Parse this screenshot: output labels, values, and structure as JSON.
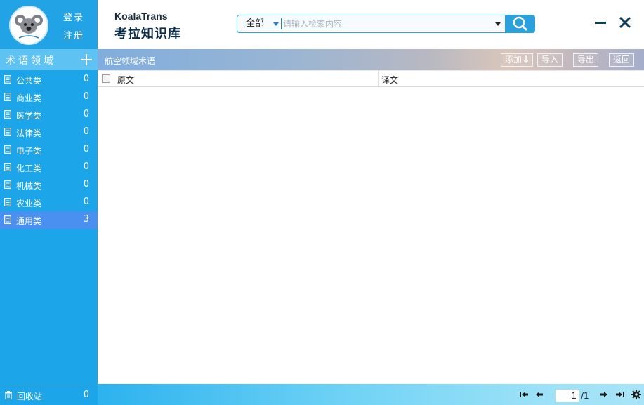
{
  "colors": {
    "sidebar": "#1ca6e9",
    "sidebar_active": "#4a90f0",
    "accent": "#2aa0dd",
    "brand_text": "#0b2d4a"
  },
  "header": {
    "logo_text": "Koala Trans",
    "login": "登录",
    "register": "注册",
    "brand_en": "KoalaTrans",
    "brand_cn": "考拉知识库",
    "search": {
      "scope": "全部",
      "placeholder": "请输入检索内容",
      "icon": "search-icon"
    },
    "window": {
      "minimize_icon": "minimize-icon",
      "close_icon": "close-icon"
    }
  },
  "sidebar": {
    "title": "术语领域",
    "add_icon": "plus-icon",
    "items": [
      {
        "label": "公共类",
        "count": "0",
        "active": false
      },
      {
        "label": "商业类",
        "count": "0",
        "active": false
      },
      {
        "label": "医学类",
        "count": "0",
        "active": false
      },
      {
        "label": "法律类",
        "count": "0",
        "active": false
      },
      {
        "label": "电子类",
        "count": "0",
        "active": false
      },
      {
        "label": "化工类",
        "count": "0",
        "active": false
      },
      {
        "label": "机械类",
        "count": "0",
        "active": false
      },
      {
        "label": "农业类",
        "count": "0",
        "active": false
      },
      {
        "label": "通用类",
        "count": "3",
        "active": true
      }
    ],
    "recycle": {
      "label": "回收站",
      "count": "0"
    }
  },
  "toolbar": {
    "breadcrumb": "航空领域术语",
    "add": "添加",
    "add_icon": "arrow-down-icon",
    "import": "导入",
    "export": "导出",
    "back": "返回"
  },
  "table": {
    "columns": [
      "原文",
      "译文"
    ],
    "rows": []
  },
  "pager": {
    "current": "1",
    "total": "/1"
  }
}
